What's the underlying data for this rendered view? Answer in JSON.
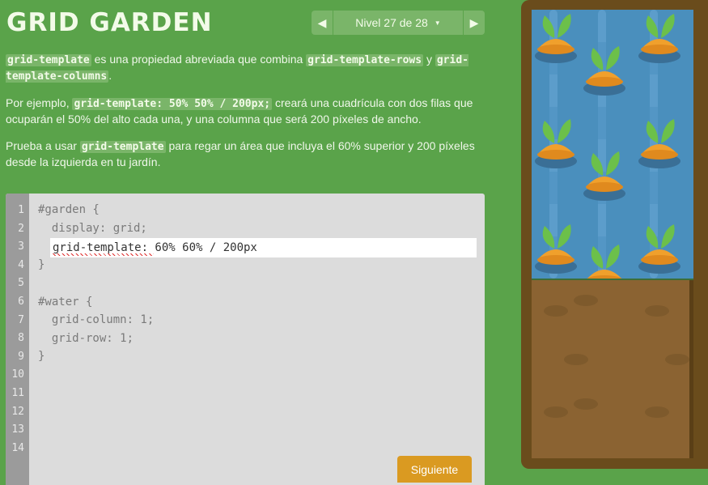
{
  "app": {
    "title": "GRID GARDEN"
  },
  "level_nav": {
    "prev_icon": "triangle-left-icon",
    "next_icon": "triangle-right-icon",
    "label": "Nivel 27 de 28",
    "dropdown_icon": "caret-down-icon"
  },
  "instructions": {
    "p1": {
      "code1": "grid-template",
      "text1": " es una propiedad abreviada que combina ",
      "code2": "grid-template-rows",
      "text2": " y ",
      "code3": "grid-template-columns",
      "text3": "."
    },
    "p2": {
      "text1": "Por ejemplo, ",
      "code1": "grid-template: 50% 50% / 200px;",
      "text2": " creará una cuadrícula con dos filas que ocuparán el 50% del alto cada una, y una columna que será 200 píxeles de ancho."
    },
    "p3": {
      "text1": "Prueba a usar ",
      "code1": "grid-template",
      "text2": " para regar un área que incluya el 60% superior y 200 píxeles desde la izquierda en tu jardín."
    }
  },
  "editor": {
    "line_numbers": [
      "1",
      "2",
      "3",
      "4",
      "5",
      "6",
      "7",
      "8",
      "9",
      "10",
      "11",
      "12",
      "13",
      "14"
    ],
    "lines": {
      "l1": "#garden {",
      "l2": "  display: grid;",
      "l4": "}",
      "l6": "#water {",
      "l7": "  grid-column: 1;",
      "l8": "  grid-row: 1;",
      "l9": "}"
    },
    "input_value": "grid-template: 60% 60% / 200px",
    "next_button": "Siguiente"
  },
  "garden": {
    "colors": {
      "water": "#4a8fbd",
      "soil": "#8b6332",
      "frame": "#6a4c1c",
      "carrot": "#f0a02c",
      "leaf": "#6cc04a"
    },
    "carrot_icon": "carrot-icon"
  }
}
